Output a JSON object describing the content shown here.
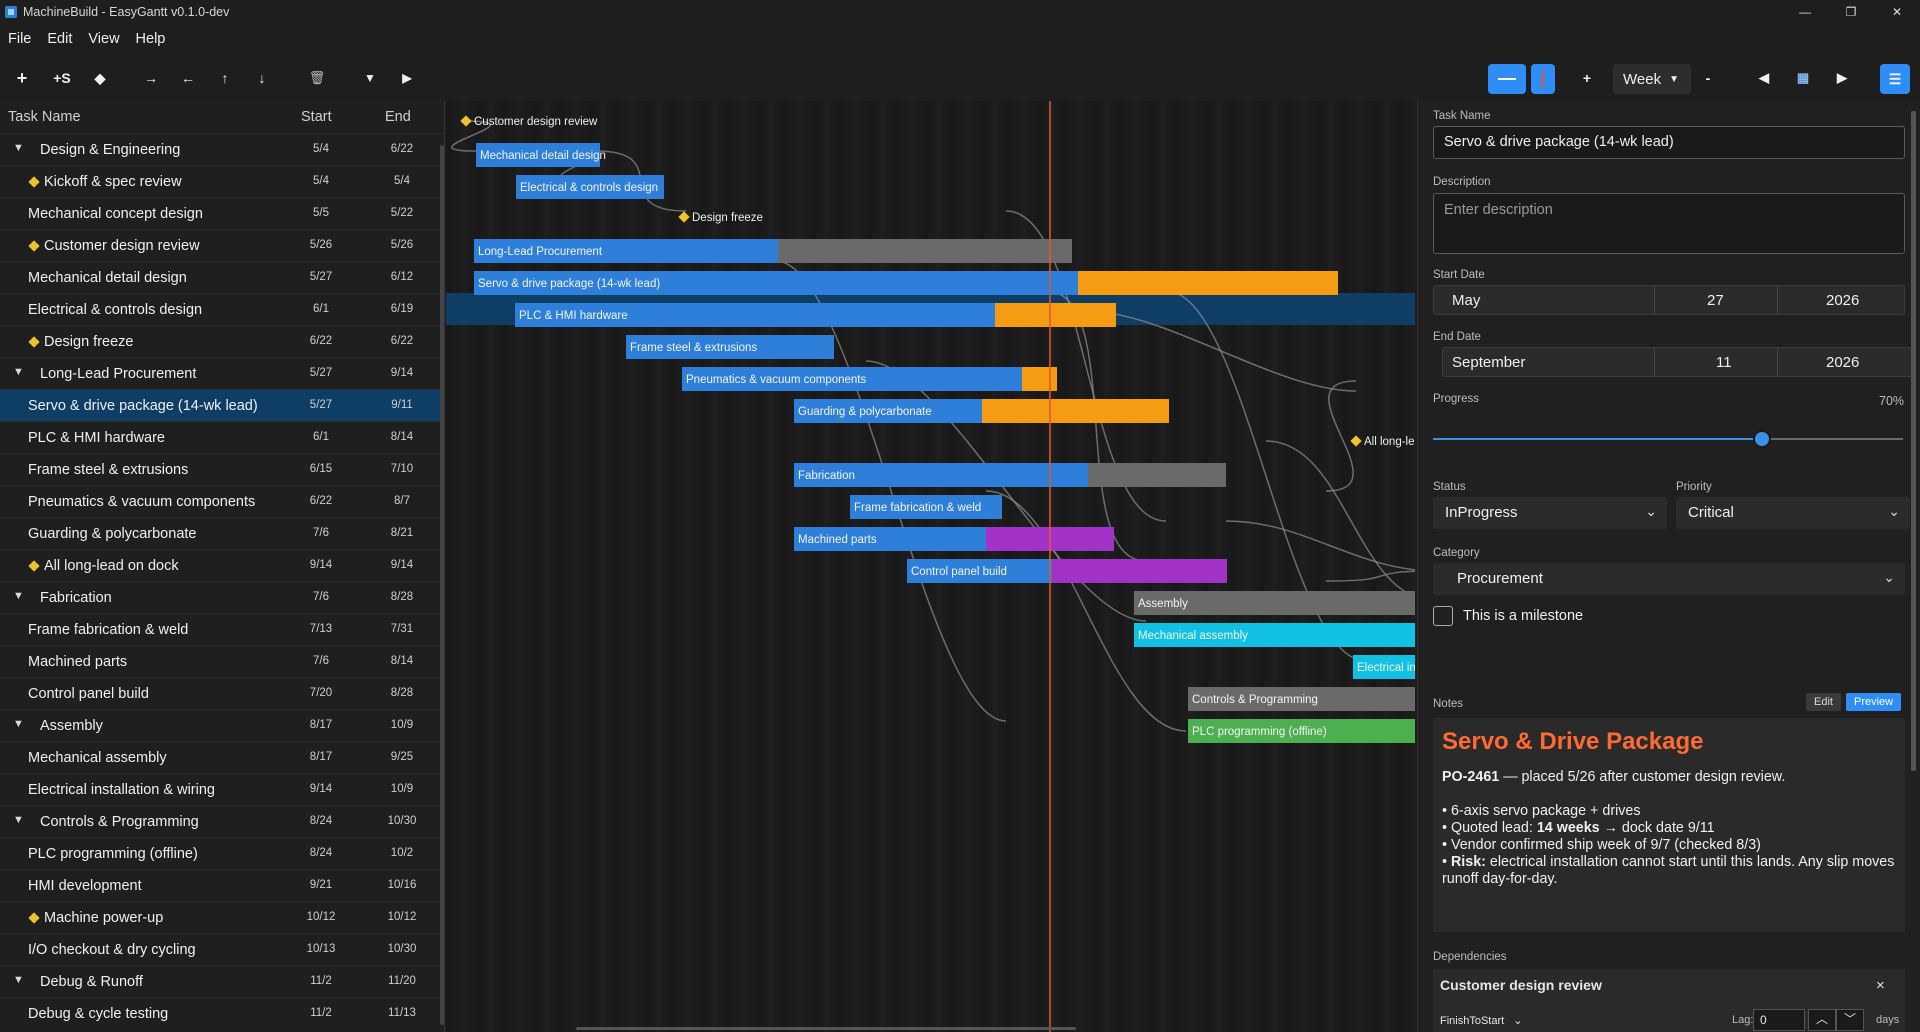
{
  "window": {
    "title": "MachineBuild - EasyGantt v0.1.0-dev",
    "controls": [
      "—",
      "❐",
      "✕"
    ]
  },
  "menu": [
    "File",
    "Edit",
    "View",
    "Help"
  ],
  "toolbar": {
    "add": "+",
    "add_sub": "+S",
    "milestone": "◆",
    "indent": "→",
    "outdent": "←",
    "up": "↑",
    "down": "↓",
    "delete": "🗑",
    "collapse": "▼",
    "expand": "▶",
    "zoom_in": "+",
    "zoom_out": "-",
    "scale": "Week",
    "prev": "◀",
    "today": "▦",
    "next": "▶",
    "menu": "☰"
  },
  "tasklist": {
    "headers": {
      "name": "Task Name",
      "start": "Start",
      "end": "End"
    },
    "rows": [
      {
        "name": "Design & Engineering",
        "start": "5/4",
        "end": "6/22",
        "type": "group"
      },
      {
        "name": "Kickoff & spec review",
        "start": "5/4",
        "end": "5/4",
        "type": "milestone"
      },
      {
        "name": "Mechanical concept design",
        "start": "5/5",
        "end": "5/22",
        "type": "task"
      },
      {
        "name": "Customer design review",
        "start": "5/26",
        "end": "5/26",
        "type": "milestone"
      },
      {
        "name": "Mechanical detail design",
        "start": "5/27",
        "end": "6/12",
        "type": "task"
      },
      {
        "name": "Electrical & controls design",
        "start": "6/1",
        "end": "6/19",
        "type": "task"
      },
      {
        "name": "Design freeze",
        "start": "6/22",
        "end": "6/22",
        "type": "milestone"
      },
      {
        "name": "Long-Lead Procurement",
        "start": "5/27",
        "end": "9/14",
        "type": "group"
      },
      {
        "name": "Servo & drive package (14-wk lead)",
        "start": "5/27",
        "end": "9/11",
        "type": "task",
        "selected": true
      },
      {
        "name": "PLC & HMI hardware",
        "start": "6/1",
        "end": "8/14",
        "type": "task"
      },
      {
        "name": "Frame steel & extrusions",
        "start": "6/15",
        "end": "7/10",
        "type": "task"
      },
      {
        "name": "Pneumatics & vacuum components",
        "start": "6/22",
        "end": "8/7",
        "type": "task"
      },
      {
        "name": "Guarding & polycarbonate",
        "start": "7/6",
        "end": "8/21",
        "type": "task"
      },
      {
        "name": "All long-lead on dock",
        "start": "9/14",
        "end": "9/14",
        "type": "milestone"
      },
      {
        "name": "Fabrication",
        "start": "7/6",
        "end": "8/28",
        "type": "group"
      },
      {
        "name": "Frame fabrication & weld",
        "start": "7/13",
        "end": "7/31",
        "type": "task"
      },
      {
        "name": "Machined parts",
        "start": "7/6",
        "end": "8/14",
        "type": "task"
      },
      {
        "name": "Control panel build",
        "start": "7/20",
        "end": "8/28",
        "type": "task"
      },
      {
        "name": "Assembly",
        "start": "8/17",
        "end": "10/9",
        "type": "group"
      },
      {
        "name": "Mechanical assembly",
        "start": "8/17",
        "end": "9/25",
        "type": "task"
      },
      {
        "name": "Electrical installation & wiring",
        "start": "9/14",
        "end": "10/9",
        "type": "task"
      },
      {
        "name": "Controls & Programming",
        "start": "8/24",
        "end": "10/30",
        "type": "group"
      },
      {
        "name": "PLC programming (offline)",
        "start": "8/24",
        "end": "10/2",
        "type": "task"
      },
      {
        "name": "HMI development",
        "start": "9/21",
        "end": "10/16",
        "type": "task"
      },
      {
        "name": "Machine power-up",
        "start": "10/12",
        "end": "10/12",
        "type": "milestone"
      },
      {
        "name": "I/O checkout & dry cycling",
        "start": "10/13",
        "end": "10/30",
        "type": "task"
      },
      {
        "name": "Debug & Runoff",
        "start": "11/2",
        "end": "11/20",
        "type": "group"
      },
      {
        "name": "Debug & cycle testing",
        "start": "11/2",
        "end": "11/13",
        "type": "task"
      }
    ]
  },
  "gantt": {
    "colors": {
      "task": "#2e7fd9",
      "remaining": "#f59c12",
      "group_rem": "#6a6a6a",
      "machined": "#a333c8",
      "assembly": "#11c1e4",
      "programming": "#4caf50",
      "milestone": "#f2c12e",
      "today": "#e4572e"
    },
    "bars": [
      {
        "label": "Customer design review",
        "row": 0,
        "kind": "milestone"
      },
      {
        "label": "Mechanical detail design",
        "row": 1,
        "kind": "task"
      },
      {
        "label": "Electrical & controls design",
        "row": 2,
        "kind": "task"
      },
      {
        "label": "Design freeze",
        "row": 3,
        "kind": "milestone"
      },
      {
        "label": "Long-Lead Procurement",
        "row": 4,
        "kind": "group"
      },
      {
        "label": "Servo & drive package (14-wk lead)",
        "row": 5,
        "kind": "task",
        "progress": 0.7
      },
      {
        "label": "PLC & HMI hardware",
        "row": 6,
        "kind": "task"
      },
      {
        "label": "Frame steel & extrusions",
        "row": 7,
        "kind": "task"
      },
      {
        "label": "Pneumatics & vacuum components",
        "row": 8,
        "kind": "task"
      },
      {
        "label": "Guarding & polycarbonate",
        "row": 9,
        "kind": "task"
      },
      {
        "label": "All long-lead on dock",
        "row": 10,
        "kind": "milestone"
      },
      {
        "label": "Fabrication",
        "row": 11,
        "kind": "group"
      },
      {
        "label": "Frame fabrication & weld",
        "row": 12,
        "kind": "task"
      },
      {
        "label": "Machined parts",
        "row": 13,
        "kind": "task"
      },
      {
        "label": "Control panel build",
        "row": 14,
        "kind": "task"
      },
      {
        "label": "Assembly",
        "row": 15,
        "kind": "group"
      },
      {
        "label": "Mechanical assembly",
        "row": 16,
        "kind": "task"
      },
      {
        "label": "Electrical installation & wiring",
        "row": 17,
        "kind": "task"
      },
      {
        "label": "Controls & Programming",
        "row": 18,
        "kind": "group"
      },
      {
        "label": "PLC programming (offline)",
        "row": 19,
        "kind": "task"
      }
    ]
  },
  "details": {
    "task_name_label": "Task Name",
    "task_name": "Servo & drive package (14-wk lead)",
    "description_label": "Description",
    "description_placeholder": "Enter description",
    "start_label": "Start Date",
    "start": {
      "month": "May",
      "day": "27",
      "year": "2026"
    },
    "end_label": "End Date",
    "end": {
      "month": "September",
      "day": "11",
      "year": "2026"
    },
    "progress_label": "Progress",
    "progress_text": "70%",
    "progress": 0.7,
    "status_label": "Status",
    "status": "InProgress",
    "priority_label": "Priority",
    "priority": "Critical",
    "category_label": "Category",
    "category": "Procurement",
    "milestone_label": "This is a milestone",
    "notes_label": "Notes",
    "notes_edit": "Edit",
    "notes_preview": "Preview",
    "notes": {
      "heading": "Servo & Drive Package",
      "po": "PO-2461",
      "po_rest": " — placed 5/26 after customer design review.",
      "b1": "• 6-axis servo package + drives",
      "b2a": "• Quoted lead: ",
      "b2b": "14 weeks",
      "b2c": " → dock date 9/11",
      "b3": "• Vendor confirmed ship week of 9/7 (checked 8/3)",
      "b4a": "• ",
      "b4b": "Risk:",
      "b4c": " electrical installation cannot start until this lands. Any slip moves runoff day-for-day."
    },
    "dependencies_label": "Dependencies",
    "dependency": {
      "name": "Customer design review",
      "type": "FinishToStart",
      "lag_label": "Lag:",
      "lag": "0",
      "unit": "days"
    }
  }
}
